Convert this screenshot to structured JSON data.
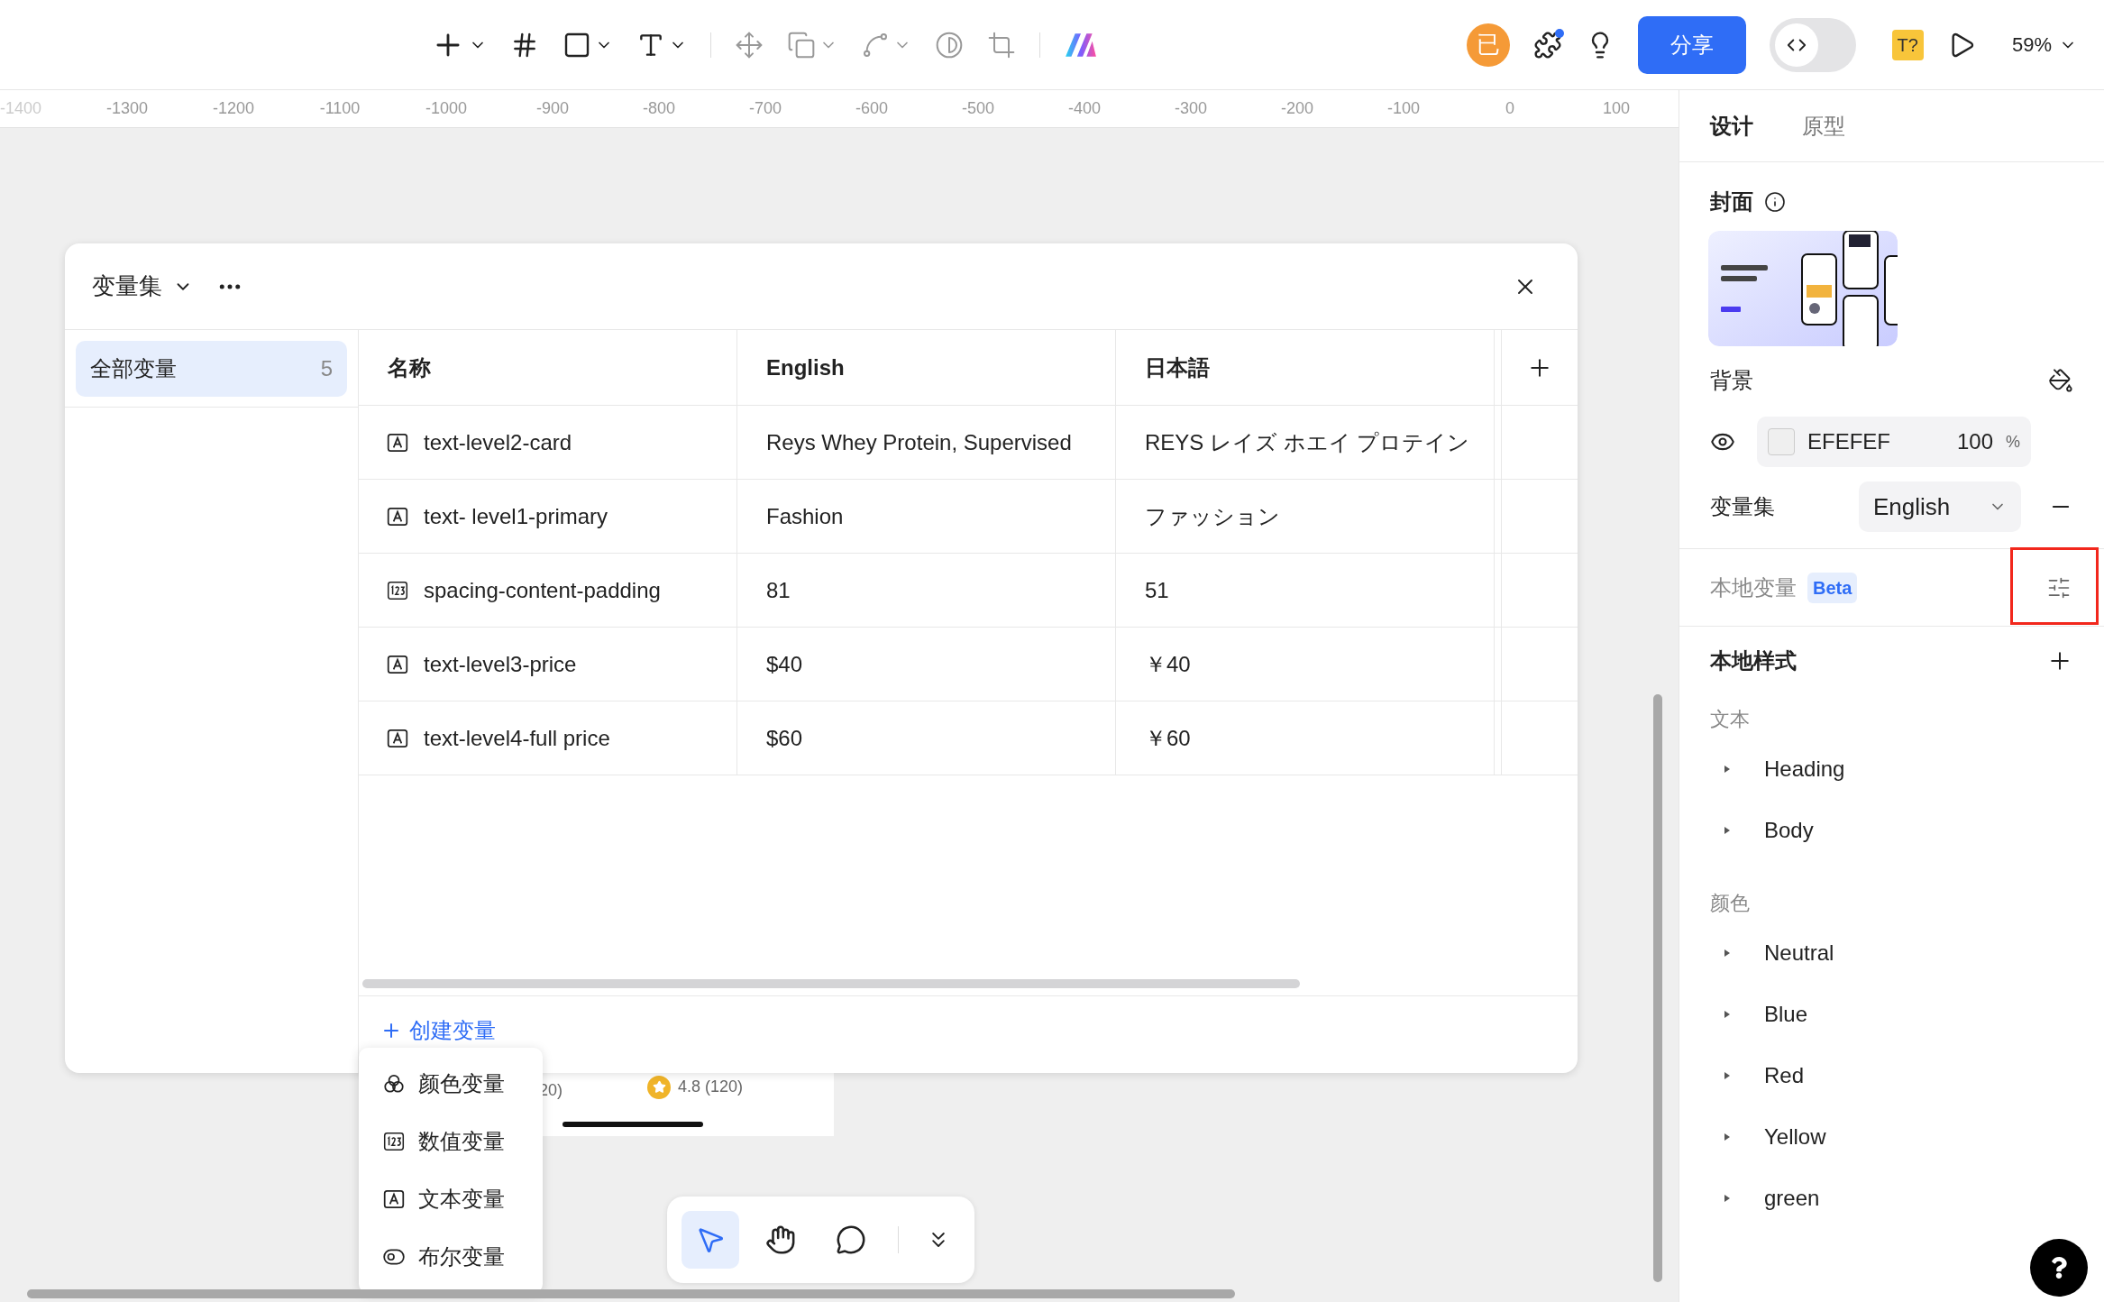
{
  "toolbar": {
    "avatar": "已",
    "share": "分享",
    "code_toggle": {
      "on": false
    },
    "badge": "T?",
    "zoom": "59%"
  },
  "ruler": [
    "-1400",
    "-1300",
    "-1200",
    "-1100",
    "-1000",
    "-900",
    "-800",
    "-700",
    "-600",
    "-500",
    "-400",
    "-300",
    "-200",
    "-100",
    "0",
    "100"
  ],
  "canvas": {
    "fragments": [
      "20)",
      "4.8 (120)"
    ]
  },
  "modal": {
    "title": "变量集",
    "sidebar": [
      {
        "label": "全部变量",
        "count": "5",
        "selected": true
      }
    ],
    "columns": [
      "名称",
      "English",
      "日本語"
    ],
    "rows": [
      {
        "kind": "text",
        "name": "text-level2-card",
        "values": [
          "Reys Whey Protein, Supervised",
          "REYS レイズ ホエイ プロテイン"
        ]
      },
      {
        "kind": "text",
        "name": "text- level1-primary",
        "values": [
          "Fashion",
          "ファッション"
        ]
      },
      {
        "kind": "number",
        "name": "spacing-content-padding",
        "values": [
          "81",
          "51"
        ]
      },
      {
        "kind": "text",
        "name": "text-level3-price",
        "values": [
          "$40",
          "￥40"
        ]
      },
      {
        "kind": "text",
        "name": "text-level4-full price",
        "values": [
          "$60",
          "￥60"
        ]
      }
    ],
    "create": "创建变量"
  },
  "menu": [
    {
      "kind": "color",
      "label": "颜色变量"
    },
    {
      "kind": "number",
      "label": "数值变量"
    },
    {
      "kind": "text",
      "label": "文本变量"
    },
    {
      "kind": "boolean",
      "label": "布尔变量"
    }
  ],
  "bottom_tools": [
    {
      "kind": "select",
      "selected": true
    },
    {
      "kind": "hand",
      "selected": false
    },
    {
      "kind": "comment",
      "selected": false
    }
  ],
  "panel": {
    "tabs": [
      {
        "label": "设计",
        "selected": true
      },
      {
        "label": "原型",
        "selected": false
      }
    ],
    "cover": {
      "title": "封面"
    },
    "background": {
      "title": "背景",
      "color": "#efefef",
      "hex": "EFEFEF",
      "opacity": "100",
      "unit": "%"
    },
    "variable_set": {
      "label": "变量集",
      "value": "English"
    },
    "local_variables": {
      "label": "本地变量",
      "badge": "Beta",
      "highlighted": true
    },
    "local_styles": {
      "title": "本地样式",
      "groups": [
        {
          "title": "文本",
          "items": [
            {
              "label": "Heading",
              "expanded": false
            },
            {
              "label": "Body",
              "expanded": false
            }
          ]
        },
        {
          "title": "颜色",
          "items": [
            {
              "label": "Neutral",
              "expanded": false
            },
            {
              "label": "Blue",
              "expanded": false
            },
            {
              "label": "Red",
              "expanded": false
            },
            {
              "label": "Yellow",
              "expanded": false
            },
            {
              "label": "green",
              "expanded": false
            }
          ]
        }
      ]
    }
  }
}
